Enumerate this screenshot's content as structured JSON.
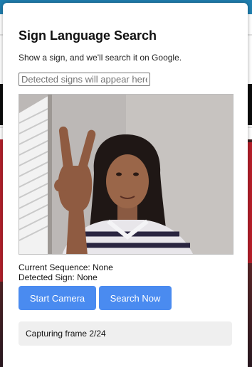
{
  "popup": {
    "title": "Sign Language Search",
    "subtitle": "Show a sign, and we'll search it on Google.",
    "search_input": {
      "value": "",
      "placeholder": "Detected signs will appear here"
    },
    "camera_feed": {
      "icon": "webcam-video-feed"
    },
    "status": {
      "current_sequence_label": "Current Sequence:",
      "current_sequence_value": "None",
      "detected_sign_label": "Detected Sign:",
      "detected_sign_value": "None"
    },
    "buttons": {
      "start_camera_label": "Start Camera",
      "search_now_label": "Search Now"
    },
    "progress_text": "Capturing frame 2/24"
  },
  "colors": {
    "button_bg": "#4a8bf0",
    "progress_bg": "#efefef",
    "background_topbar": "#1f7fb0"
  }
}
